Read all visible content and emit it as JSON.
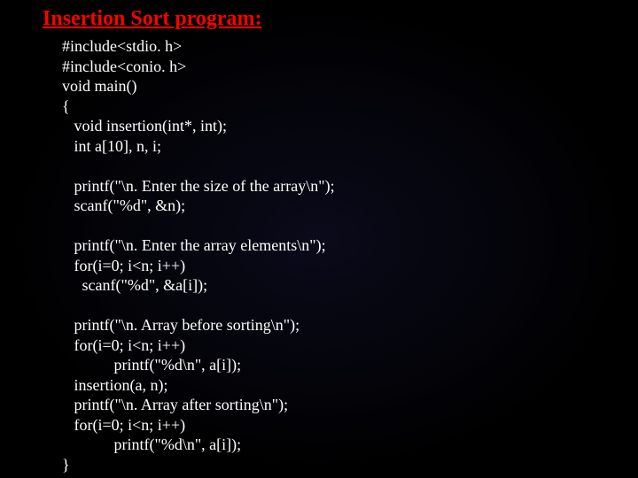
{
  "title": "Insertion Sort program:",
  "code_lines": [
    "#include<stdio. h>",
    "#include<conio. h>",
    "void main()",
    "{",
    "   void insertion(int*, int);",
    "   int a[10], n, i;",
    "",
    "   printf(\"\\n. Enter the size of the array\\n\");",
    "   scanf(\"%d\", &n);",
    "",
    "   printf(\"\\n. Enter the array elements\\n\");",
    "   for(i=0; i<n; i++)",
    "     scanf(\"%d\", &a[i]);",
    "",
    "   printf(\"\\n. Array before sorting\\n\");",
    "   for(i=0; i<n; i++)",
    "             printf(\"%d\\n\", a[i]);",
    "   insertion(a, n);",
    "   printf(\"\\n. Array after sorting\\n\");",
    "   for(i=0; i<n; i++)",
    "             printf(\"%d\\n\", a[i]);",
    "}"
  ]
}
